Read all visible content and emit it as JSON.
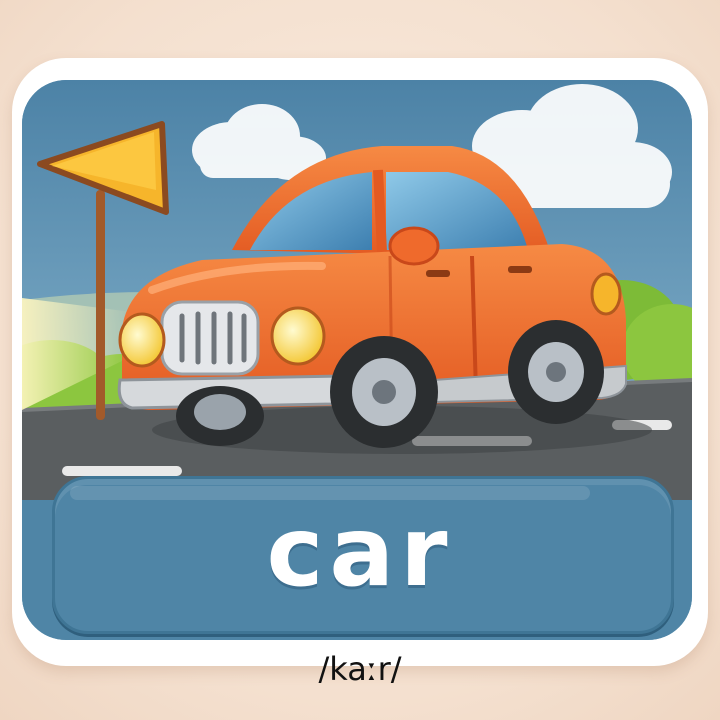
{
  "card": {
    "word": "car",
    "pronunciation": "/kaːr/"
  },
  "illustration": {
    "subject": "car-illustration",
    "colors": {
      "sky": "#5d8fb0",
      "car_body": "#ef6a2c",
      "sign": "#f6b52b",
      "bushes": "#8cc63f",
      "road": "#5a5e60",
      "label_panel": "#4f85a6"
    }
  }
}
